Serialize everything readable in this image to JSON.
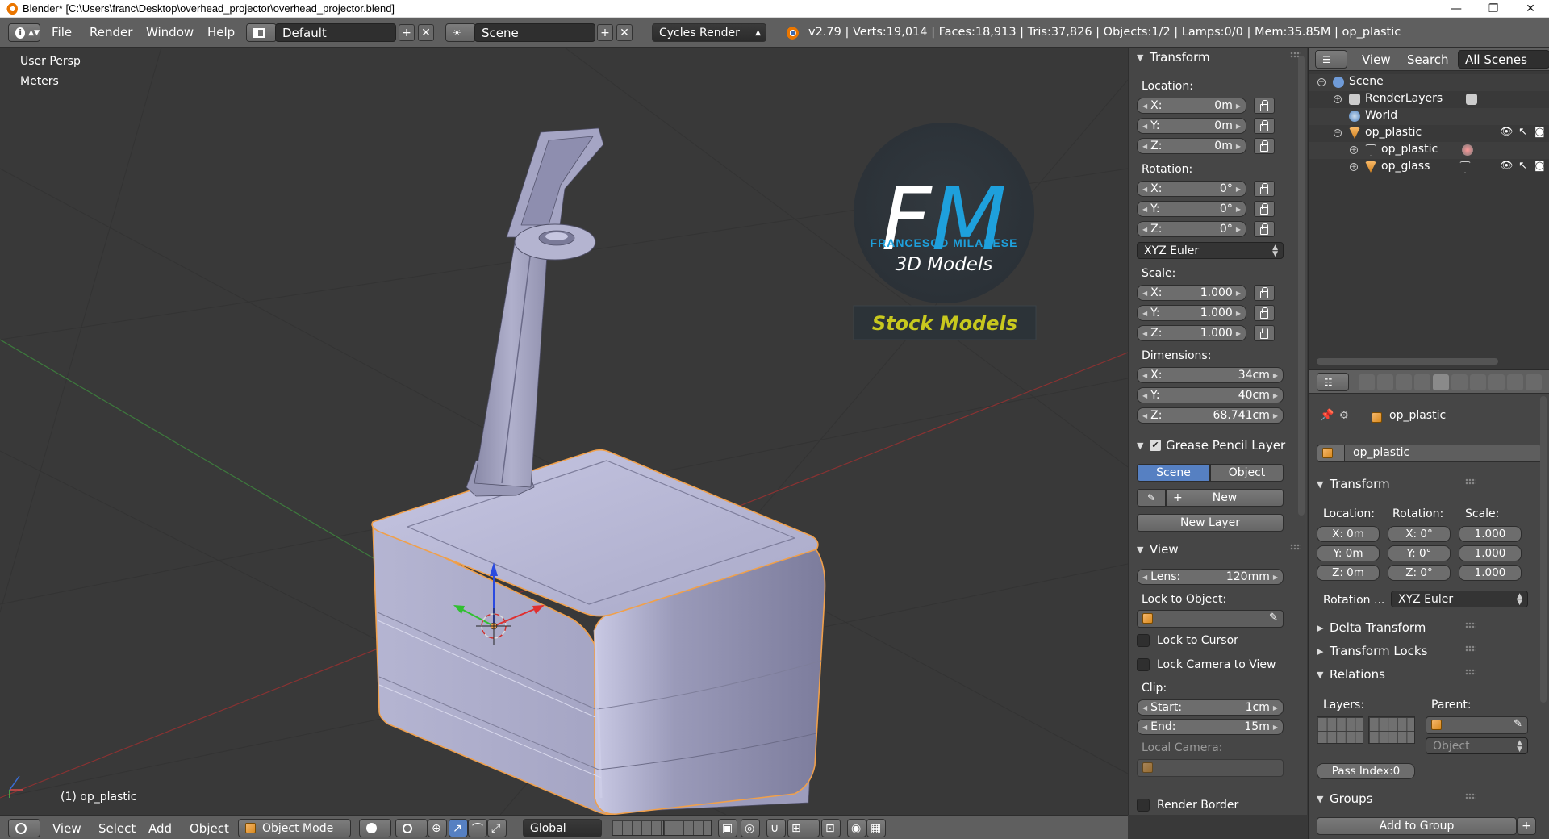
{
  "titlebar": {
    "title": "Blender* [C:\\Users\\franc\\Desktop\\overhead_projector\\overhead_projector.blend]",
    "minimize": "—",
    "maximize": "❐",
    "close": "✕"
  },
  "header": {
    "menu": [
      "File",
      "Render",
      "Window",
      "Help"
    ],
    "screen_layout": "Default",
    "scene": "Scene",
    "render_engine": "Cycles Render",
    "stats": "v2.79 | Verts:19,014 | Faces:18,913 | Tris:37,826 | Objects:1/2 | Lamps:0/0 | Mem:35.85M | op_plastic"
  },
  "viewport": {
    "view_name": "User Persp",
    "units": "Meters",
    "object_label": "(1) op_plastic",
    "watermark": {
      "initials": "FM",
      "author": "FRANCESCO MILANESE",
      "subtitle": "3D Models",
      "banner": "Stock Models"
    }
  },
  "bottom_bar": {
    "menu": [
      "View",
      "Select",
      "Add",
      "Object"
    ],
    "mode": "Object Mode",
    "orientation": "Global"
  },
  "n_panel": {
    "transform": {
      "title": "Transform",
      "location_label": "Location:",
      "location": [
        {
          "k": "X:",
          "v": "0m"
        },
        {
          "k": "Y:",
          "v": "0m"
        },
        {
          "k": "Z:",
          "v": "0m"
        }
      ],
      "rotation_label": "Rotation:",
      "rotation": [
        {
          "k": "X:",
          "v": "0°"
        },
        {
          "k": "Y:",
          "v": "0°"
        },
        {
          "k": "Z:",
          "v": "0°"
        }
      ],
      "rotation_mode": "XYZ Euler",
      "scale_label": "Scale:",
      "scale": [
        {
          "k": "X:",
          "v": "1.000"
        },
        {
          "k": "Y:",
          "v": "1.000"
        },
        {
          "k": "Z:",
          "v": "1.000"
        }
      ],
      "dimensions_label": "Dimensions:",
      "dimensions": [
        {
          "k": "X:",
          "v": "34cm"
        },
        {
          "k": "Y:",
          "v": "40cm"
        },
        {
          "k": "Z:",
          "v": "68.741cm"
        }
      ]
    },
    "grease_pencil": {
      "title": "Grease Pencil Layer",
      "tab_scene": "Scene",
      "tab_object": "Object",
      "new_label": "New",
      "new_layer_label": "New Layer"
    },
    "view": {
      "title": "View",
      "lens_key": "Lens:",
      "lens_val": "120mm",
      "lock_object_label": "Lock to Object:",
      "lock_cursor": "Lock to Cursor",
      "lock_camera": "Lock Camera to View",
      "clip_label": "Clip:",
      "clip_start_key": "Start:",
      "clip_start_val": "1cm",
      "clip_end_key": "End:",
      "clip_end_val": "15m",
      "local_camera_label": "Local Camera:",
      "render_border": "Render Border"
    }
  },
  "outliner": {
    "menu_view": "View",
    "menu_search": "Search",
    "filter": "All Scenes",
    "rows": [
      {
        "label": "Scene"
      },
      {
        "label": "RenderLayers"
      },
      {
        "label": "World"
      },
      {
        "label": "op_plastic"
      },
      {
        "label": "op_plastic"
      },
      {
        "label": "op_glass"
      }
    ]
  },
  "properties": {
    "breadcrumb_object": "op_plastic",
    "object_name": "op_plastic",
    "transform_title": "Transform",
    "location_label": "Location:",
    "rotation_label": "Rotation:",
    "scale_label": "Scale:",
    "location": [
      "X: 0m",
      "Y: 0m",
      "Z: 0m"
    ],
    "rotation": [
      "X:   0°",
      "Y:   0°",
      "Z:   0°"
    ],
    "scale": [
      "1.000",
      "1.000",
      "1.000"
    ],
    "rotation_mode_label": "Rotation ...",
    "rotation_mode": "XYZ Euler",
    "delta_transform": "Delta Transform",
    "transform_locks": "Transform Locks",
    "relations": "Relations",
    "layers_label": "Layers:",
    "parent_label": "Parent:",
    "parent_type": "Object",
    "pass_index": "Pass Index:0",
    "groups": "Groups",
    "add_to_group": "Add to Group"
  },
  "colors": {
    "accent_select": "#5680c2",
    "object_outline": "#f0a04b",
    "watermark_blue": "#1ea0dc",
    "banner_text": "#c8c81e"
  }
}
